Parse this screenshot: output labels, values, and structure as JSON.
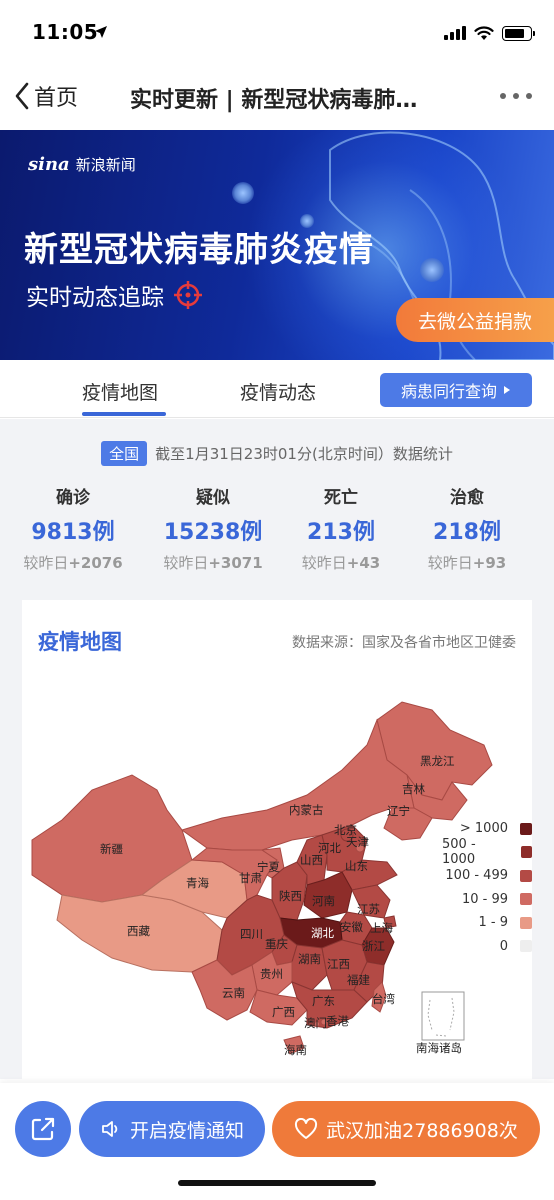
{
  "status_bar": {
    "time": "11:05"
  },
  "nav": {
    "back_label": "首页",
    "title": "实时更新 | 新型冠状病毒肺炎疫情地图"
  },
  "banner": {
    "brand": "新浪新闻",
    "brand_logo": "sina",
    "title": "新型冠状病毒肺炎疫情",
    "subtitle": "实时动态追踪",
    "donate_label": "去微公益捐款"
  },
  "tabs": [
    {
      "label": "疫情地图",
      "active": true
    },
    {
      "label": "疫情动态",
      "active": false
    }
  ],
  "peer_query_label": "病患同行查询",
  "stats": {
    "scope": "全国",
    "as_of": "截至1月31日23时01分(北京时间）数据统计",
    "items": [
      {
        "label": "确诊",
        "value": "9813",
        "unit": "例",
        "delta_prefix": "较昨日",
        "delta": "+2076"
      },
      {
        "label": "疑似",
        "value": "15238",
        "unit": "例",
        "delta_prefix": "较昨日",
        "delta": "+3071"
      },
      {
        "label": "死亡",
        "value": "213",
        "unit": "例",
        "delta_prefix": "较昨日",
        "delta": "+43"
      },
      {
        "label": "治愈",
        "value": "218",
        "unit": "例",
        "delta_prefix": "较昨日",
        "delta": "+93"
      }
    ]
  },
  "map": {
    "title": "疫情地图",
    "source": "数据来源：国家及各省市地区卫健委",
    "legend": [
      {
        "label": "> 1000",
        "color": "#6b1a1a"
      },
      {
        "label": "500 - 1000",
        "color": "#8e2d2a"
      },
      {
        "label": "100 - 499",
        "color": "#b34a45"
      },
      {
        "label": "10 - 99",
        "color": "#cf6a62"
      },
      {
        "label": "1 - 9",
        "color": "#e89a86"
      },
      {
        "label": "0",
        "color": "#eeeeee"
      }
    ],
    "provinces": {
      "heilongjiang": "黑龙江",
      "jilin": "吉林",
      "liaoning": "辽宁",
      "neimenggu": "内蒙古",
      "beijing": "北京",
      "tianjin": "天津",
      "hebei": "河北",
      "shanxi": "山西",
      "shandong": "山东",
      "xinjiang": "新疆",
      "qinghai": "青海",
      "gansu": "甘肃",
      "ningxia": "宁夏",
      "shaanxi": "陕西",
      "henan": "河南",
      "jiangsu": "江苏",
      "anhui": "安徽",
      "shanghai": "上海",
      "hubei": "湖北",
      "xizang": "西藏",
      "sichuan": "四川",
      "chongqing": "重庆",
      "zhejiang": "浙江",
      "hunan": "湖南",
      "jiangxi": "江西",
      "guizhou": "贵州",
      "fujian": "福建",
      "yunnan": "云南",
      "guangxi": "广西",
      "guangdong": "广东",
      "taiwan": "台湾",
      "aomen": "澳门",
      "xianggang": "香港",
      "hainan": "海南",
      "nanhai": "南海诸岛"
    }
  },
  "bottom": {
    "notify_label": "开启疫情通知",
    "cheer_label": "武汉加油27886908次"
  }
}
